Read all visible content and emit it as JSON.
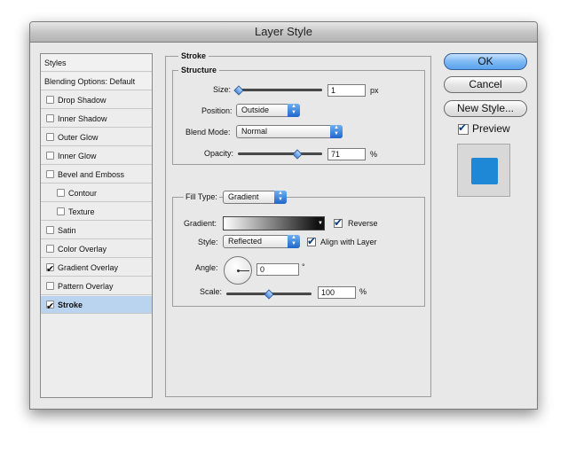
{
  "window": {
    "title": "Layer Style"
  },
  "sidebar": {
    "header": "Styles",
    "blending": "Blending Options: Default",
    "items": [
      {
        "label": "Drop Shadow",
        "checked": false,
        "indent": false,
        "selected": false
      },
      {
        "label": "Inner Shadow",
        "checked": false,
        "indent": false,
        "selected": false
      },
      {
        "label": "Outer Glow",
        "checked": false,
        "indent": false,
        "selected": false
      },
      {
        "label": "Inner Glow",
        "checked": false,
        "indent": false,
        "selected": false
      },
      {
        "label": "Bevel and Emboss",
        "checked": false,
        "indent": false,
        "selected": false
      },
      {
        "label": "Contour",
        "checked": false,
        "indent": true,
        "selected": false
      },
      {
        "label": "Texture",
        "checked": false,
        "indent": true,
        "selected": false
      },
      {
        "label": "Satin",
        "checked": false,
        "indent": false,
        "selected": false
      },
      {
        "label": "Color Overlay",
        "checked": false,
        "indent": false,
        "selected": false
      },
      {
        "label": "Gradient Overlay",
        "checked": true,
        "indent": false,
        "selected": false
      },
      {
        "label": "Pattern Overlay",
        "checked": false,
        "indent": false,
        "selected": false
      },
      {
        "label": "Stroke",
        "checked": true,
        "indent": false,
        "selected": true
      }
    ]
  },
  "stroke": {
    "title": "Stroke",
    "structure": {
      "title": "Structure",
      "size_label": "Size:",
      "size_value": "1",
      "size_unit": "px",
      "size_level": 0.01,
      "position_label": "Position:",
      "position_value": "Outside",
      "blend_label": "Blend Mode:",
      "blend_value": "Normal",
      "opacity_label": "Opacity:",
      "opacity_value": "71",
      "opacity_unit": "%",
      "opacity_level": 0.71
    },
    "fill": {
      "filltype_label": "Fill Type:",
      "filltype_value": "Gradient",
      "gradient_label": "Gradient:",
      "reverse_label": "Reverse",
      "reverse_checked": true,
      "style_label": "Style:",
      "style_value": "Reflected",
      "align_label": "Align with Layer",
      "align_checked": true,
      "angle_label": "Angle:",
      "angle_value": "0",
      "angle_unit": "°",
      "scale_label": "Scale:",
      "scale_value": "100",
      "scale_unit": "%",
      "scale_level": 0.5
    }
  },
  "buttons": {
    "ok": "OK",
    "cancel": "Cancel",
    "new_style": "New Style...",
    "preview": "Preview"
  },
  "preview": {
    "checked": true,
    "swatch_color": "#1e88d6"
  },
  "colors": {
    "accent": "#5aa3ee",
    "selection": "#bad4f0"
  }
}
